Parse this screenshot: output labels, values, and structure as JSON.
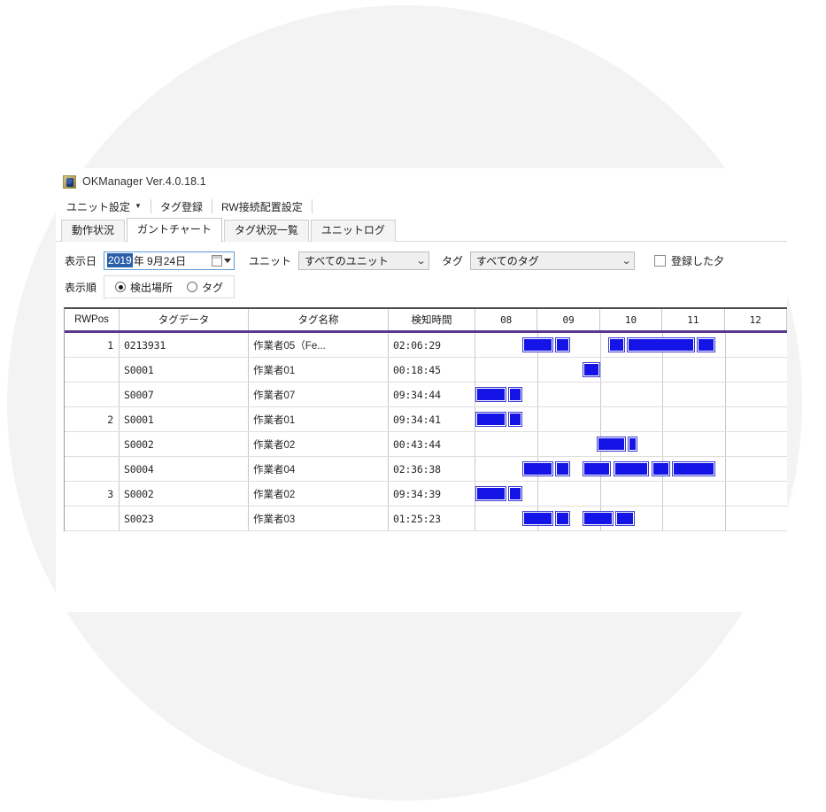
{
  "window": {
    "title": "OKManager Ver.4.0.18.1",
    "icon": "app-icon"
  },
  "menubar": {
    "items": [
      {
        "label": "ユニット設定",
        "has_caret": true
      },
      {
        "label": "タグ登録",
        "has_caret": false
      },
      {
        "label": "RW接続配置設定",
        "has_caret": false
      }
    ]
  },
  "tabs": [
    {
      "label": "動作状況",
      "active": false
    },
    {
      "label": "ガントチャート",
      "active": true
    },
    {
      "label": "タグ状況一覧",
      "active": false
    },
    {
      "label": "ユニットログ",
      "active": false
    }
  ],
  "filters": {
    "display_date_label": "表示日",
    "date": {
      "year": "2019",
      "rest": "年 9月24日"
    },
    "unit_label": "ユニット",
    "unit_value": "すべてのユニット",
    "tag_label": "タグ",
    "tag_value": "すべてのタグ",
    "registered_checkbox_label": "登録した夕",
    "registered_checked": false,
    "order_label": "表示順",
    "order_options": [
      {
        "label": "検出場所",
        "selected": true
      },
      {
        "label": "タグ",
        "selected": false
      }
    ]
  },
  "grid": {
    "columns": [
      {
        "key": "rwpos",
        "label": "RWPos"
      },
      {
        "key": "tagdata",
        "label": "タグデータ"
      },
      {
        "key": "tagname",
        "label": "タグ名称"
      },
      {
        "key": "detect",
        "label": "検知時間"
      }
    ],
    "time_columns": [
      "08",
      "09",
      "10",
      "11",
      "12"
    ],
    "rows": [
      {
        "rwpos": "1",
        "tagdata": "0213931",
        "tagname": "作業者05（Fe...",
        "detect": "02:06:29",
        "bars": [
          [
            8.75,
            9.25
          ],
          [
            9.28,
            9.52
          ],
          [
            10.13,
            10.4
          ],
          [
            10.43,
            11.52
          ],
          [
            11.55,
            11.85
          ]
        ]
      },
      {
        "rwpos": "",
        "tagdata": "S0001",
        "tagname": "作業者01",
        "detect": "00:18:45",
        "bars": [
          [
            9.72,
            10.0
          ]
        ]
      },
      {
        "rwpos": "",
        "tagdata": "S0007",
        "tagname": "作業者07",
        "detect": "09:34:44",
        "bars": [
          [
            8.0,
            8.5
          ],
          [
            8.53,
            8.75
          ]
        ]
      },
      {
        "rwpos": "2",
        "tagdata": "S0001",
        "tagname": "作業者01",
        "detect": "09:34:41",
        "bars": [
          [
            8.0,
            8.5
          ],
          [
            8.53,
            8.75
          ]
        ]
      },
      {
        "rwpos": "",
        "tagdata": "S0002",
        "tagname": "作業者02",
        "detect": "00:43:44",
        "bars": [
          [
            9.95,
            10.42
          ],
          [
            10.45,
            10.6
          ]
        ]
      },
      {
        "rwpos": "",
        "tagdata": "S0004",
        "tagname": "作業者04",
        "detect": "02:36:38",
        "bars": [
          [
            8.75,
            9.25
          ],
          [
            9.28,
            9.52
          ],
          [
            9.72,
            10.18
          ],
          [
            10.22,
            10.78
          ],
          [
            10.82,
            11.12
          ],
          [
            11.15,
            11.85
          ]
        ]
      },
      {
        "rwpos": "3",
        "tagdata": "S0002",
        "tagname": "作業者02",
        "detect": "09:34:39",
        "bars": [
          [
            8.0,
            8.5
          ],
          [
            8.53,
            8.75
          ]
        ]
      },
      {
        "rwpos": "",
        "tagdata": "S0023",
        "tagname": "作業者03",
        "detect": "01:25:23",
        "bars": [
          [
            8.75,
            9.25
          ],
          [
            9.28,
            9.52
          ],
          [
            9.72,
            10.22
          ],
          [
            10.25,
            10.55
          ]
        ]
      }
    ]
  },
  "colors": {
    "bar": "#1414e6",
    "header_rule": "#5b3a8e",
    "date_highlight": "#2a5ea8",
    "background_circle": "#f3f3f3"
  }
}
